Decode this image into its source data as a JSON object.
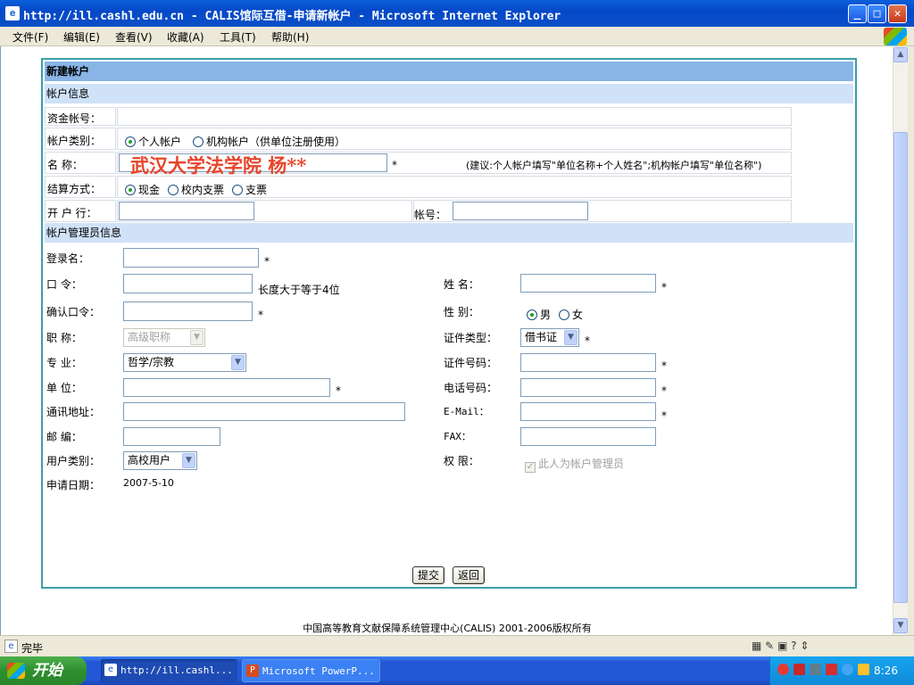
{
  "window": {
    "title": "http://ill.cashl.edu.cn - CALIS馆际互借-申请新帐户 - Microsoft Internet Explorer",
    "minimize": "_",
    "maximize": "□",
    "close": "✕"
  },
  "menu": [
    "文件(F)",
    "编辑(E)",
    "查看(V)",
    "收藏(A)",
    "工具(T)",
    "帮助(H)"
  ],
  "form": {
    "header": "新建帐户",
    "account_section": "帐户信息",
    "fund_account_label": "资金帐号：",
    "account_type_label": "帐户类别：",
    "account_type_options": [
      "个人帐户",
      "机构帐户（供单位注册使用）"
    ],
    "account_type_selected": 0,
    "name_label": "名 称：",
    "name_value": "武汉大学法学院  杨**",
    "name_hint": "(建议:个人帐户填写\"单位名称+个人姓名\";机构帐户填写\"单位名称\")",
    "settlement_label": "结算方式：",
    "settlement_options": [
      "现金",
      "校内支票",
      "支票"
    ],
    "settlement_selected": 0,
    "bank_label": "开 户 行：",
    "account_no_label": "帐号：",
    "admin_section": "帐户管理员信息",
    "login_label": "登录名：",
    "password_label": "口 令：",
    "password_hint": "长度大于等于4位",
    "confirm_label": "确认口令：",
    "title_label": "职 称：",
    "title_value": "高级职称",
    "major_label": "专 业：",
    "major_value": "哲学/宗教",
    "unit_label": "单 位：",
    "address_label": "通讯地址：",
    "zip_label": "邮 编：",
    "user_type_label": "用户类别：",
    "user_type_value": "高校用户",
    "apply_date_label": "申请日期：",
    "apply_date_value": "2007-5-10",
    "realname_label": "姓 名：",
    "gender_label": "性 别：",
    "gender_options": [
      "男",
      "女"
    ],
    "gender_selected": 0,
    "id_type_label": "证件类型：",
    "id_type_value": "借书证",
    "id_no_label": "证件号码：",
    "phone_label": "电话号码：",
    "email_label": "E-Mail：",
    "fax_label": "FAX：",
    "permission_label": "权 限：",
    "permission_checkbox": "此人为帐户管理员",
    "required_mark": "*",
    "submit": "提交",
    "back": "返回"
  },
  "footer": "中国高等教育文献保障系统管理中心(CALIS) 2001-2006版权所有",
  "status": "完毕",
  "taskbar": {
    "start": "开始",
    "tasks": [
      "http://ill.cashl...",
      "Microsoft PowerP..."
    ],
    "clock": "8:26"
  }
}
